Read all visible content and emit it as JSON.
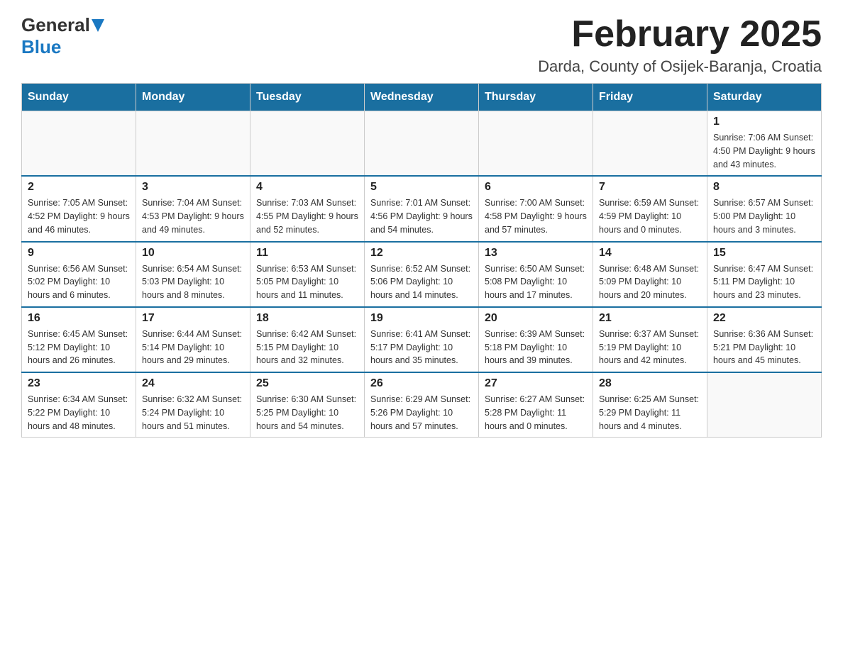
{
  "logo": {
    "general": "General",
    "blue": "Blue"
  },
  "title": "February 2025",
  "location": "Darda, County of Osijek-Baranja, Croatia",
  "days_of_week": [
    "Sunday",
    "Monday",
    "Tuesday",
    "Wednesday",
    "Thursday",
    "Friday",
    "Saturday"
  ],
  "weeks": [
    [
      {
        "day": "",
        "info": ""
      },
      {
        "day": "",
        "info": ""
      },
      {
        "day": "",
        "info": ""
      },
      {
        "day": "",
        "info": ""
      },
      {
        "day": "",
        "info": ""
      },
      {
        "day": "",
        "info": ""
      },
      {
        "day": "1",
        "info": "Sunrise: 7:06 AM\nSunset: 4:50 PM\nDaylight: 9 hours\nand 43 minutes."
      }
    ],
    [
      {
        "day": "2",
        "info": "Sunrise: 7:05 AM\nSunset: 4:52 PM\nDaylight: 9 hours\nand 46 minutes."
      },
      {
        "day": "3",
        "info": "Sunrise: 7:04 AM\nSunset: 4:53 PM\nDaylight: 9 hours\nand 49 minutes."
      },
      {
        "day": "4",
        "info": "Sunrise: 7:03 AM\nSunset: 4:55 PM\nDaylight: 9 hours\nand 52 minutes."
      },
      {
        "day": "5",
        "info": "Sunrise: 7:01 AM\nSunset: 4:56 PM\nDaylight: 9 hours\nand 54 minutes."
      },
      {
        "day": "6",
        "info": "Sunrise: 7:00 AM\nSunset: 4:58 PM\nDaylight: 9 hours\nand 57 minutes."
      },
      {
        "day": "7",
        "info": "Sunrise: 6:59 AM\nSunset: 4:59 PM\nDaylight: 10 hours\nand 0 minutes."
      },
      {
        "day": "8",
        "info": "Sunrise: 6:57 AM\nSunset: 5:00 PM\nDaylight: 10 hours\nand 3 minutes."
      }
    ],
    [
      {
        "day": "9",
        "info": "Sunrise: 6:56 AM\nSunset: 5:02 PM\nDaylight: 10 hours\nand 6 minutes."
      },
      {
        "day": "10",
        "info": "Sunrise: 6:54 AM\nSunset: 5:03 PM\nDaylight: 10 hours\nand 8 minutes."
      },
      {
        "day": "11",
        "info": "Sunrise: 6:53 AM\nSunset: 5:05 PM\nDaylight: 10 hours\nand 11 minutes."
      },
      {
        "day": "12",
        "info": "Sunrise: 6:52 AM\nSunset: 5:06 PM\nDaylight: 10 hours\nand 14 minutes."
      },
      {
        "day": "13",
        "info": "Sunrise: 6:50 AM\nSunset: 5:08 PM\nDaylight: 10 hours\nand 17 minutes."
      },
      {
        "day": "14",
        "info": "Sunrise: 6:48 AM\nSunset: 5:09 PM\nDaylight: 10 hours\nand 20 minutes."
      },
      {
        "day": "15",
        "info": "Sunrise: 6:47 AM\nSunset: 5:11 PM\nDaylight: 10 hours\nand 23 minutes."
      }
    ],
    [
      {
        "day": "16",
        "info": "Sunrise: 6:45 AM\nSunset: 5:12 PM\nDaylight: 10 hours\nand 26 minutes."
      },
      {
        "day": "17",
        "info": "Sunrise: 6:44 AM\nSunset: 5:14 PM\nDaylight: 10 hours\nand 29 minutes."
      },
      {
        "day": "18",
        "info": "Sunrise: 6:42 AM\nSunset: 5:15 PM\nDaylight: 10 hours\nand 32 minutes."
      },
      {
        "day": "19",
        "info": "Sunrise: 6:41 AM\nSunset: 5:17 PM\nDaylight: 10 hours\nand 35 minutes."
      },
      {
        "day": "20",
        "info": "Sunrise: 6:39 AM\nSunset: 5:18 PM\nDaylight: 10 hours\nand 39 minutes."
      },
      {
        "day": "21",
        "info": "Sunrise: 6:37 AM\nSunset: 5:19 PM\nDaylight: 10 hours\nand 42 minutes."
      },
      {
        "day": "22",
        "info": "Sunrise: 6:36 AM\nSunset: 5:21 PM\nDaylight: 10 hours\nand 45 minutes."
      }
    ],
    [
      {
        "day": "23",
        "info": "Sunrise: 6:34 AM\nSunset: 5:22 PM\nDaylight: 10 hours\nand 48 minutes."
      },
      {
        "day": "24",
        "info": "Sunrise: 6:32 AM\nSunset: 5:24 PM\nDaylight: 10 hours\nand 51 minutes."
      },
      {
        "day": "25",
        "info": "Sunrise: 6:30 AM\nSunset: 5:25 PM\nDaylight: 10 hours\nand 54 minutes."
      },
      {
        "day": "26",
        "info": "Sunrise: 6:29 AM\nSunset: 5:26 PM\nDaylight: 10 hours\nand 57 minutes."
      },
      {
        "day": "27",
        "info": "Sunrise: 6:27 AM\nSunset: 5:28 PM\nDaylight: 11 hours\nand 0 minutes."
      },
      {
        "day": "28",
        "info": "Sunrise: 6:25 AM\nSunset: 5:29 PM\nDaylight: 11 hours\nand 4 minutes."
      },
      {
        "day": "",
        "info": ""
      }
    ]
  ]
}
